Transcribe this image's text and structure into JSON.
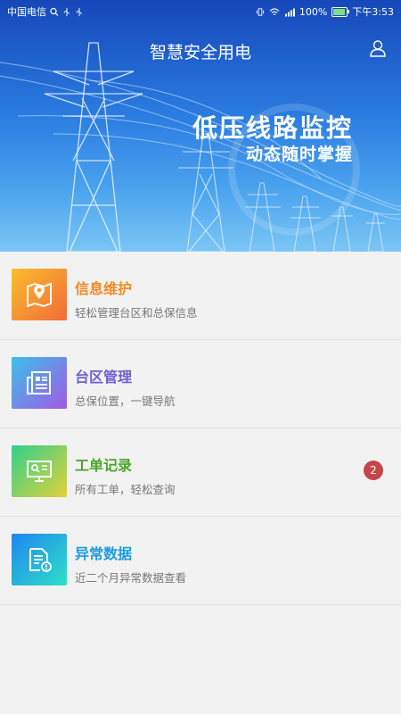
{
  "statusbar": {
    "carrier": "中国电信",
    "battery": "100%",
    "time": "下午3:53"
  },
  "header": {
    "title": "智慧安全用电",
    "user_icon": "user-icon"
  },
  "banner": {
    "slogan_main": "低压线路监控",
    "slogan_sub": "动态随时掌握"
  },
  "menu": [
    {
      "title": "信息维护",
      "desc": "轻松管理台区和总保信息",
      "icon": "map-pin-icon",
      "color": "#f08a24"
    },
    {
      "title": "台区管理",
      "desc": "总保位置，一键导航",
      "icon": "document-icon",
      "color": "#6a5fd0"
    },
    {
      "title": "工单记录",
      "desc": "所有工单，轻松查询",
      "icon": "monitor-icon",
      "color": "#4aa52a",
      "badge": "2"
    },
    {
      "title": "异常数据",
      "desc": "近二个月异常数据查看",
      "icon": "alert-file-icon",
      "color": "#1c9be0"
    }
  ],
  "colors": {
    "badge": "#c6454a",
    "banner_top": "#1647b8",
    "banner_bottom": "#7cc6f5"
  }
}
